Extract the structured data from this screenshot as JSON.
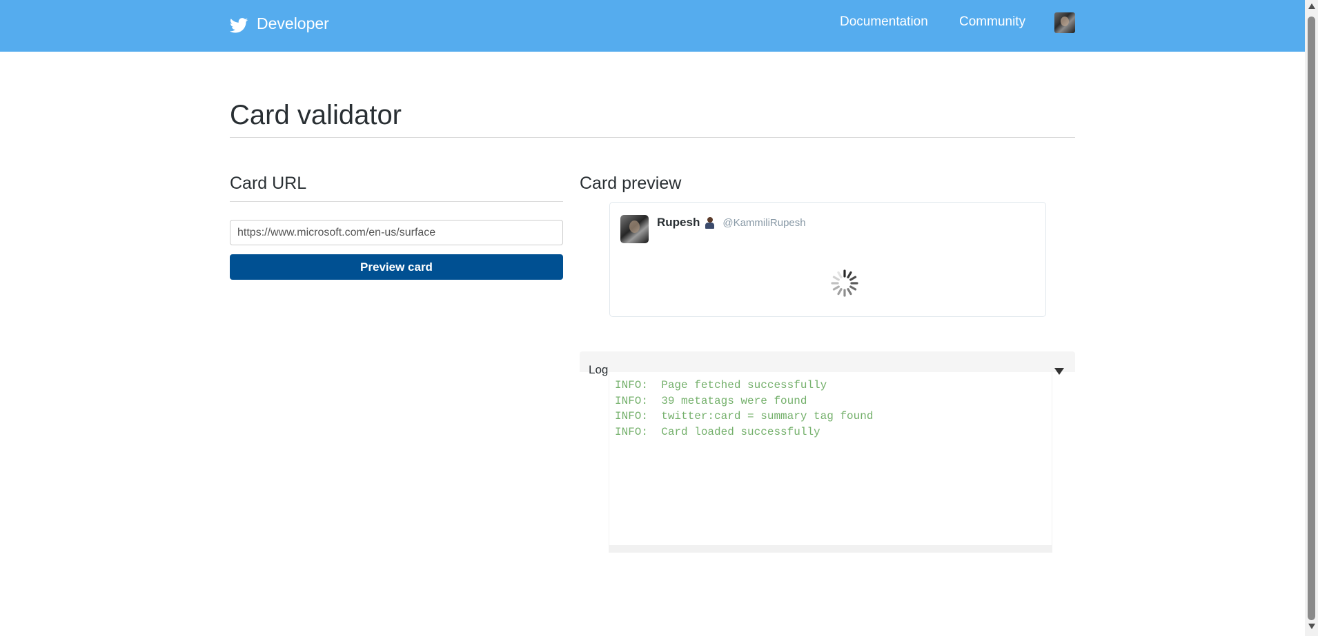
{
  "header": {
    "brand_label": "Developer",
    "brand_icon": "twitter-bird-icon",
    "nav": {
      "documentation": "Documentation",
      "community": "Community"
    },
    "avatar": "user-avatar",
    "background_color": "#55acee"
  },
  "main": {
    "title": "Card validator",
    "card_url": {
      "heading": "Card URL",
      "input_value": "https://www.microsoft.com/en-us/surface",
      "button_label": "Preview card",
      "button_color": "#005092"
    },
    "card_preview": {
      "heading": "Card preview",
      "user_name": "Rupesh",
      "user_handle": "@KammiliRupesh",
      "name_emoji": "person-emoji-icon",
      "status": "loading-spinner-icon"
    },
    "log": {
      "label": "Log",
      "toggle_icon": "caret-down-icon",
      "lines": [
        "INFO:  Page fetched successfully",
        "INFO:  39 metatags were found",
        "INFO:  twitter:card = summary tag found",
        "INFO:  Card loaded successfully"
      ],
      "text_color": "#74b06b"
    }
  }
}
